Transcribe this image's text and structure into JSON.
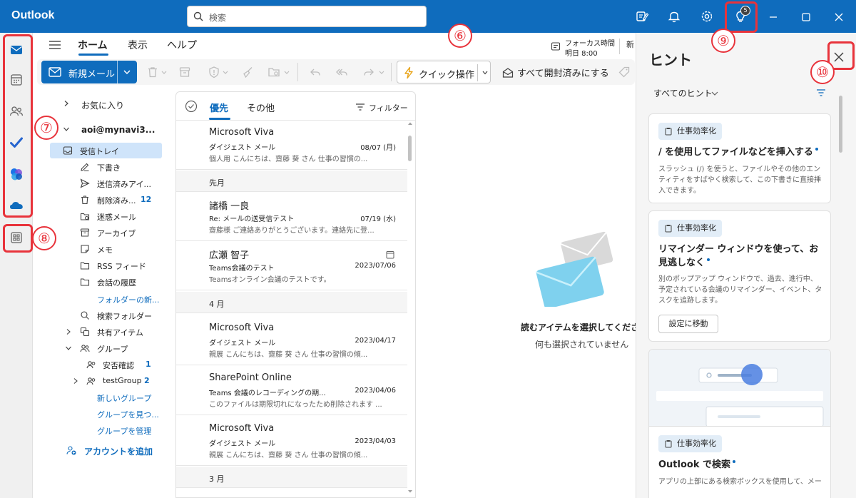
{
  "app": {
    "name": "Outlook"
  },
  "search": {
    "placeholder": "検索"
  },
  "titlebar": {
    "hints_badge": "5"
  },
  "annotations": {
    "n6": "⑥",
    "n7": "⑦",
    "n8": "⑧",
    "n9": "⑨",
    "n10": "⑩"
  },
  "ribbon": {
    "tabs": [
      "ホーム",
      "表示",
      "ヘルプ"
    ],
    "focus_title": "フォーカス時間",
    "focus_time": "明日 8:00",
    "focus_more": "新",
    "new_mail": "新規メール",
    "quick_action": "クイック操作",
    "mark_all_read": "すべて開封済みにする"
  },
  "folders": {
    "favorites": "お気に入り",
    "account": "aoi@mynavi3...",
    "items": [
      {
        "label": "受信トレイ",
        "icon": "inbox-icon"
      },
      {
        "label": "下書き",
        "icon": "pencil-icon"
      },
      {
        "label": "送信済みアイ...",
        "icon": "send-icon"
      },
      {
        "label": "削除済み...",
        "icon": "trash-icon",
        "count": "12"
      },
      {
        "label": "迷惑メール",
        "icon": "junk-icon"
      },
      {
        "label": "アーカイブ",
        "icon": "archive-icon"
      },
      {
        "label": "メモ",
        "icon": "note-icon"
      },
      {
        "label": "RSS フィード",
        "icon": "folder-icon"
      },
      {
        "label": "会話の履歴",
        "icon": "folder-icon"
      },
      {
        "label": "フォルダーの新..."
      },
      {
        "label": "検索フォルダー",
        "icon": "search-folder-icon"
      },
      {
        "label": "共有アイテム",
        "icon": "shared-icon"
      },
      {
        "label": "グループ",
        "icon": "group-icon"
      },
      {
        "label": "安否確認",
        "icon": "group-icon",
        "count": "1"
      },
      {
        "label": "testGroup",
        "icon": "group-icon",
        "count": "2"
      },
      {
        "label": "新しいグループ"
      },
      {
        "label": "グループを見つ..."
      },
      {
        "label": "グループを管理"
      }
    ],
    "add_account": "アカウントを追加"
  },
  "message_list": {
    "tab_focused": "優先",
    "tab_other": "その他",
    "filter": "フィルター",
    "groups": [
      "先月",
      "4 月",
      "3 月"
    ],
    "messages": [
      {
        "from": "Microsoft Viva",
        "subject": "ダイジェスト メール",
        "date": "08/07 (月)",
        "preview": "個人用 こんにちは、齋藤 葵 さん 仕事の習慣の..."
      },
      {
        "from": "諸橋 一良",
        "subject": "Re: メールの送受信テスト",
        "date": "07/19 (水)",
        "preview": "齋藤様 ご連絡ありがとうございます。連絡先に登..."
      },
      {
        "from": "広瀬 智子",
        "subject": "Teams会議のテスト",
        "date": "2023/07/06",
        "preview": "Teamsオンライン会議のテストです。"
      },
      {
        "from": "Microsoft Viva",
        "subject": "ダイジェスト メール",
        "date": "2023/04/17",
        "preview": "親展 こんにちは、齋藤 葵 さん 仕事の習慣の傾..."
      },
      {
        "from": "SharePoint Online",
        "subject": "Teams 会議のレコーディングの期...",
        "date": "2023/04/06",
        "preview": "このファイルは期限切れになったため削除されます ..."
      },
      {
        "from": "Microsoft Viva",
        "subject": "ダイジェスト メール",
        "date": "2023/04/03",
        "preview": "親展 こんにちは、齋藤 葵 さん 仕事の習慣の傾..."
      }
    ]
  },
  "reading_pane": {
    "title": "読むアイテムを選択してください",
    "subtitle": "何も選択されていません"
  },
  "hints": {
    "title": "ヒント",
    "filter": "すべてのヒント",
    "cards": [
      {
        "category": "仕事効率化",
        "title": "/ を使用してファイルなどを挿入する",
        "body": "スラッシュ (/) を使うと、ファイルやその他のエンティティをすばやく検索して、この下書きに直接挿入できます。"
      },
      {
        "category": "仕事効率化",
        "title": "リマインダー ウィンドウを使って、お見逃しなく",
        "body": "別のポップアップ ウィンドウで、過去、進行中、予定されている会議のリマインダー、イベント、タスクを追跡します。",
        "button": "設定に移動"
      },
      {
        "category": "仕事効率化",
        "title": "Outlook で検索",
        "body": "アプリの上部にある検索ボックスを使用して、メー"
      }
    ]
  },
  "colors": {
    "accent": "#0f6cbd",
    "annotation": "#e8333b"
  }
}
